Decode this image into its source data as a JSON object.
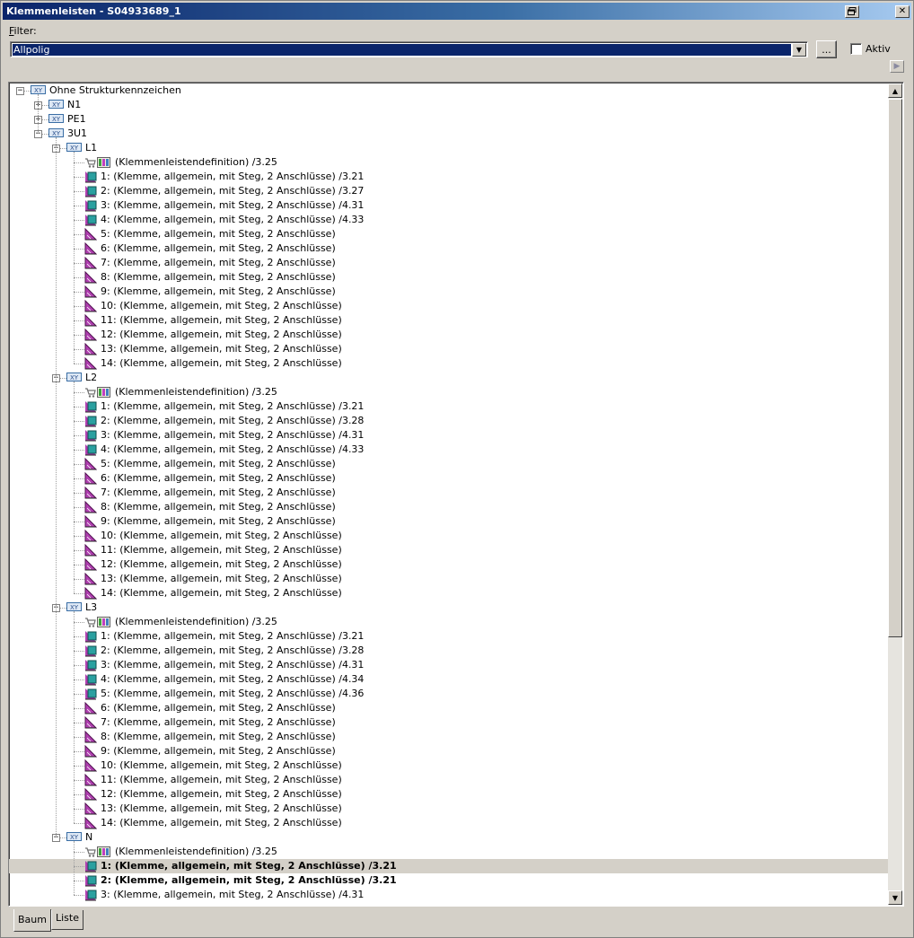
{
  "window": {
    "title": "Klemmenleisten - S04933689_1"
  },
  "filter": {
    "label_prefix": "F",
    "label_rest": "ilter:",
    "value": "Allpolig",
    "dots_label": "...",
    "aktiv_label": "Aktiv"
  },
  "colors": {
    "title_start": "#0a246a",
    "title_end": "#a6caf0",
    "selection": "#0a246a",
    "window_bg": "#d4d0c8"
  },
  "tree": {
    "rows": [
      {
        "level": 0,
        "expander": "minus",
        "icon": "folder-xy-icon",
        "text": "Ohne Strukturkennzeichen"
      },
      {
        "level": 1,
        "expander": "plus",
        "icon": "folder-xy-icon",
        "text": "N1"
      },
      {
        "level": 1,
        "expander": "plus",
        "icon": "folder-xy-icon",
        "text": "PE1"
      },
      {
        "level": 1,
        "expander": "minus",
        "icon": "folder-xy-icon",
        "text": "3U1"
      },
      {
        "level": 2,
        "expander": "minus",
        "icon": "folder-xy-icon",
        "text": "L1"
      },
      {
        "level": 3,
        "icon": "definition-icon",
        "text": "(Klemmenleistendefinition) /3.25"
      },
      {
        "level": 3,
        "icon": "terminal-placed-icon",
        "text": "1: (Klemme, allgemein, mit Steg, 2 Anschlüsse) /3.21"
      },
      {
        "level": 3,
        "icon": "terminal-placed-icon",
        "text": "2: (Klemme, allgemein, mit Steg, 2 Anschlüsse) /3.27"
      },
      {
        "level": 3,
        "icon": "terminal-placed-icon",
        "text": "3: (Klemme, allgemein, mit Steg, 2 Anschlüsse) /4.31"
      },
      {
        "level": 3,
        "icon": "terminal-placed-icon",
        "text": "4: (Klemme, allgemein, mit Steg, 2 Anschlüsse) /4.33"
      },
      {
        "level": 3,
        "icon": "terminal-unplaced-icon",
        "text": "5: (Klemme, allgemein, mit Steg, 2 Anschlüsse)"
      },
      {
        "level": 3,
        "icon": "terminal-unplaced-icon",
        "text": "6: (Klemme, allgemein, mit Steg, 2 Anschlüsse)"
      },
      {
        "level": 3,
        "icon": "terminal-unplaced-icon",
        "text": "7: (Klemme, allgemein, mit Steg, 2 Anschlüsse)"
      },
      {
        "level": 3,
        "icon": "terminal-unplaced-icon",
        "text": "8: (Klemme, allgemein, mit Steg, 2 Anschlüsse)"
      },
      {
        "level": 3,
        "icon": "terminal-unplaced-icon",
        "text": "9: (Klemme, allgemein, mit Steg, 2 Anschlüsse)"
      },
      {
        "level": 3,
        "icon": "terminal-unplaced-icon",
        "text": "10: (Klemme, allgemein, mit Steg, 2 Anschlüsse)"
      },
      {
        "level": 3,
        "icon": "terminal-unplaced-icon",
        "text": "11: (Klemme, allgemein, mit Steg, 2 Anschlüsse)"
      },
      {
        "level": 3,
        "icon": "terminal-unplaced-icon",
        "text": "12: (Klemme, allgemein, mit Steg, 2 Anschlüsse)"
      },
      {
        "level": 3,
        "icon": "terminal-unplaced-icon",
        "text": "13: (Klemme, allgemein, mit Steg, 2 Anschlüsse)"
      },
      {
        "level": 3,
        "icon": "terminal-unplaced-icon",
        "text": "14: (Klemme, allgemein, mit Steg, 2 Anschlüsse)"
      },
      {
        "level": 2,
        "expander": "minus",
        "icon": "folder-xy-icon",
        "text": "L2"
      },
      {
        "level": 3,
        "icon": "definition-icon",
        "text": "(Klemmenleistendefinition) /3.25"
      },
      {
        "level": 3,
        "icon": "terminal-placed-icon",
        "text": "1: (Klemme, allgemein, mit Steg, 2 Anschlüsse) /3.21"
      },
      {
        "level": 3,
        "icon": "terminal-placed-icon",
        "text": "2: (Klemme, allgemein, mit Steg, 2 Anschlüsse) /3.28"
      },
      {
        "level": 3,
        "icon": "terminal-placed-icon",
        "text": "3: (Klemme, allgemein, mit Steg, 2 Anschlüsse) /4.31"
      },
      {
        "level": 3,
        "icon": "terminal-placed-icon",
        "text": "4: (Klemme, allgemein, mit Steg, 2 Anschlüsse) /4.33"
      },
      {
        "level": 3,
        "icon": "terminal-unplaced-icon",
        "text": "5: (Klemme, allgemein, mit Steg, 2 Anschlüsse)"
      },
      {
        "level": 3,
        "icon": "terminal-unplaced-icon",
        "text": "6: (Klemme, allgemein, mit Steg, 2 Anschlüsse)"
      },
      {
        "level": 3,
        "icon": "terminal-unplaced-icon",
        "text": "7: (Klemme, allgemein, mit Steg, 2 Anschlüsse)"
      },
      {
        "level": 3,
        "icon": "terminal-unplaced-icon",
        "text": "8: (Klemme, allgemein, mit Steg, 2 Anschlüsse)"
      },
      {
        "level": 3,
        "icon": "terminal-unplaced-icon",
        "text": "9: (Klemme, allgemein, mit Steg, 2 Anschlüsse)"
      },
      {
        "level": 3,
        "icon": "terminal-unplaced-icon",
        "text": "10: (Klemme, allgemein, mit Steg, 2 Anschlüsse)"
      },
      {
        "level": 3,
        "icon": "terminal-unplaced-icon",
        "text": "11: (Klemme, allgemein, mit Steg, 2 Anschlüsse)"
      },
      {
        "level": 3,
        "icon": "terminal-unplaced-icon",
        "text": "12: (Klemme, allgemein, mit Steg, 2 Anschlüsse)"
      },
      {
        "level": 3,
        "icon": "terminal-unplaced-icon",
        "text": "13: (Klemme, allgemein, mit Steg, 2 Anschlüsse)"
      },
      {
        "level": 3,
        "icon": "terminal-unplaced-icon",
        "text": "14: (Klemme, allgemein, mit Steg, 2 Anschlüsse)"
      },
      {
        "level": 2,
        "expander": "minus",
        "icon": "folder-xy-icon",
        "text": "L3"
      },
      {
        "level": 3,
        "icon": "definition-icon",
        "text": "(Klemmenleistendefinition) /3.25"
      },
      {
        "level": 3,
        "icon": "terminal-placed-icon",
        "text": "1: (Klemme, allgemein, mit Steg, 2 Anschlüsse) /3.21"
      },
      {
        "level": 3,
        "icon": "terminal-placed-icon",
        "text": "2: (Klemme, allgemein, mit Steg, 2 Anschlüsse) /3.28"
      },
      {
        "level": 3,
        "icon": "terminal-placed-icon",
        "text": "3: (Klemme, allgemein, mit Steg, 2 Anschlüsse) /4.31"
      },
      {
        "level": 3,
        "icon": "terminal-placed-icon",
        "text": "4: (Klemme, allgemein, mit Steg, 2 Anschlüsse) /4.34"
      },
      {
        "level": 3,
        "icon": "terminal-placed-icon",
        "text": "5: (Klemme, allgemein, mit Steg, 2 Anschlüsse) /4.36"
      },
      {
        "level": 3,
        "icon": "terminal-unplaced-icon",
        "text": "6: (Klemme, allgemein, mit Steg, 2 Anschlüsse)"
      },
      {
        "level": 3,
        "icon": "terminal-unplaced-icon",
        "text": "7: (Klemme, allgemein, mit Steg, 2 Anschlüsse)"
      },
      {
        "level": 3,
        "icon": "terminal-unplaced-icon",
        "text": "8: (Klemme, allgemein, mit Steg, 2 Anschlüsse)"
      },
      {
        "level": 3,
        "icon": "terminal-unplaced-icon",
        "text": "9: (Klemme, allgemein, mit Steg, 2 Anschlüsse)"
      },
      {
        "level": 3,
        "icon": "terminal-unplaced-icon",
        "text": "10: (Klemme, allgemein, mit Steg, 2 Anschlüsse)"
      },
      {
        "level": 3,
        "icon": "terminal-unplaced-icon",
        "text": "11: (Klemme, allgemein, mit Steg, 2 Anschlüsse)"
      },
      {
        "level": 3,
        "icon": "terminal-unplaced-icon",
        "text": "12: (Klemme, allgemein, mit Steg, 2 Anschlüsse)"
      },
      {
        "level": 3,
        "icon": "terminal-unplaced-icon",
        "text": "13: (Klemme, allgemein, mit Steg, 2 Anschlüsse)"
      },
      {
        "level": 3,
        "icon": "terminal-unplaced-icon",
        "text": "14: (Klemme, allgemein, mit Steg, 2 Anschlüsse)"
      },
      {
        "level": 2,
        "expander": "minus",
        "icon": "folder-xy-icon",
        "text": "N"
      },
      {
        "level": 3,
        "icon": "definition-icon",
        "text": "(Klemmenleistendefinition) /3.25"
      },
      {
        "level": 3,
        "icon": "terminal-placed-icon",
        "text": "1: (Klemme, allgemein, mit Steg, 2 Anschlüsse) /3.21",
        "selected": true,
        "bold": true
      },
      {
        "level": 3,
        "icon": "terminal-placed-icon",
        "text": "2: (Klemme, allgemein, mit Steg, 2 Anschlüsse) /3.21",
        "bold": true
      },
      {
        "level": 3,
        "icon": "terminal-placed-icon",
        "text": "3: (Klemme, allgemein, mit Steg, 2 Anschlüsse) /4.31"
      }
    ]
  },
  "tabs": [
    {
      "label": "Baum",
      "active": true
    },
    {
      "label": "Liste",
      "active": false
    }
  ]
}
